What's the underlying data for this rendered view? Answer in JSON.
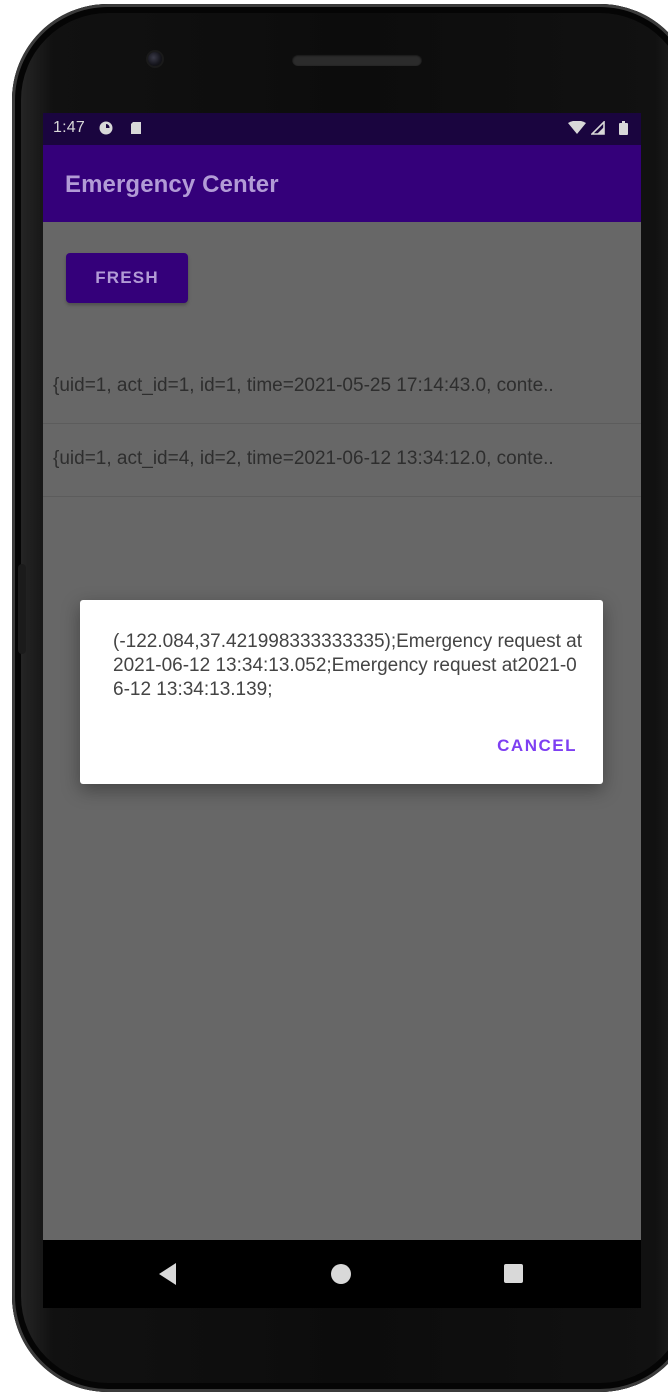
{
  "status_bar": {
    "time": "1:47",
    "icons": [
      "data-saver-icon",
      "sd-card-icon",
      "wifi-icon",
      "signal-icon",
      "battery-icon"
    ]
  },
  "app_bar": {
    "title": "Emergency Center"
  },
  "toolbar": {
    "fresh_label": "FRESH"
  },
  "list": {
    "items": [
      {
        "text": "{uid=1, act_id=1, id=1, time=2021-05-25 17:14:43.0, conte.."
      },
      {
        "text": "{uid=1, act_id=4, id=2, time=2021-06-12 13:34:12.0, conte.."
      }
    ]
  },
  "dialog": {
    "message": "(-122.084,37.421998333333335);Emergency request at2021-06-12 13:34:13.052;Emergency request at2021-06-12 13:34:13.139;",
    "cancel_label": "CANCEL"
  },
  "nav_bar": {
    "icons": [
      "back-icon",
      "home-icon",
      "recents-icon"
    ]
  },
  "colors": {
    "app_bar": "#34007a",
    "status_bar": "#1a053f",
    "scrim": "#676767",
    "accent": "#7e3ff2"
  }
}
